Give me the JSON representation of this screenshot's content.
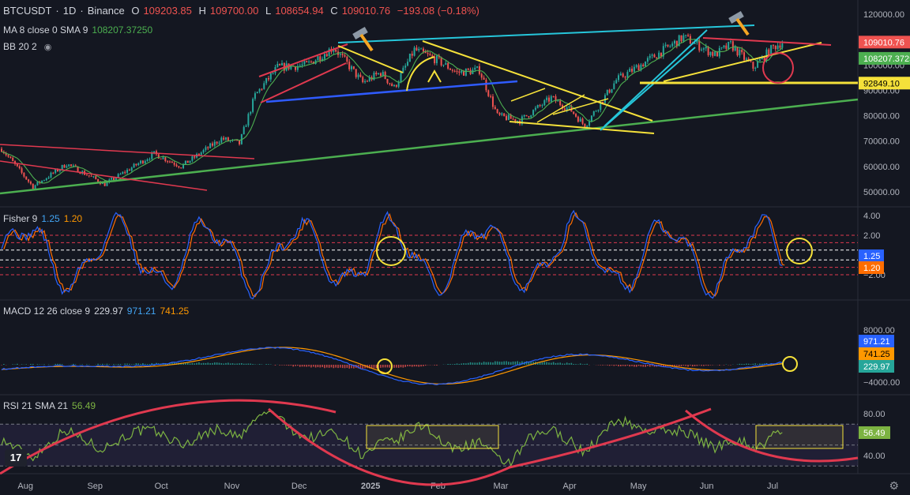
{
  "header": {
    "symbol": "BTCUSDT",
    "sep1": "·",
    "interval": "1D",
    "sep2": "·",
    "exchange": "Binance",
    "open_label": "O",
    "open": "109203.85",
    "high_label": "H",
    "high": "109700.00",
    "low_label": "L",
    "low": "108654.94",
    "close_label": "C",
    "close": "109010.76",
    "change": "−193.08 (−0.18%)"
  },
  "indicators": {
    "ma_label": "MA 8 close 0 SMA 9",
    "ma_value": "108207.37250",
    "bb_label": "BB 20 2",
    "fisher_label": "Fisher 9",
    "fisher_v1": "1.25",
    "fisher_v2": "1.20",
    "macd_label": "MACD 12 26 close 9",
    "macd_hist": "229.97",
    "macd_line": "971.21",
    "macd_signal": "741.25",
    "rsi_label": "RSI 21 SMA 21",
    "rsi_value": "56.49"
  },
  "colors": {
    "background": "#141721",
    "up": "#26a69a",
    "down": "#ef5350",
    "ma": "#4caf50",
    "fisher": "#2962ff",
    "fisher_trigger": "#ff6d00",
    "macd": "#2962ff",
    "signal": "#ff9800",
    "rsi": "#7cb342",
    "annot_red": "#e0394f",
    "annot_yellow": "#f5e13a",
    "annot_cyan": "#26c6da",
    "annot_blue": "#2f5bff",
    "annot_green": "#4caf50"
  },
  "chart_data": [
    {
      "type": "candlestick",
      "title": "BTCUSDT · 1D · Binance",
      "x_tick_labels": [
        "Aug",
        "Sep",
        "Oct",
        "Nov",
        "Dec",
        "2025",
        "Feb",
        "Mar",
        "Apr",
        "May",
        "Jun",
        "Jul"
      ],
      "y_tick_labels": [
        "120000.00",
        "110000.00",
        "100000.00",
        "90000.00",
        "80000.00",
        "70000.00",
        "60000.00",
        "50000.00"
      ],
      "ylim": [
        45000,
        122000
      ],
      "price_path": [
        [
          "Jul 22",
          67000
        ],
        [
          "Aug 5",
          52000
        ],
        [
          "Aug 20",
          61000
        ],
        [
          "Sep 6",
          53000
        ],
        [
          "Sep 28",
          65000
        ],
        [
          "Oct 10",
          60000
        ],
        [
          "Oct 28",
          71000
        ],
        [
          "Nov 5",
          69000
        ],
        [
          "Nov 12",
          88000
        ],
        [
          "Nov 22",
          99000
        ],
        [
          "Dec 5",
          100000
        ],
        [
          "Dec 17",
          107000
        ],
        [
          "Dec 30",
          93000
        ],
        [
          "Jan 7",
          97000
        ],
        [
          "Jan 13",
          91000
        ],
        [
          "Jan 22",
          106000
        ],
        [
          "Feb 1",
          102000
        ],
        [
          "Feb 10",
          97000
        ],
        [
          "Feb 20",
          98000
        ],
        [
          "Feb 28",
          80000
        ],
        [
          "Mar 10",
          78000
        ],
        [
          "Mar 24",
          87000
        ],
        [
          "Apr 2",
          82000
        ],
        [
          "Apr 8",
          76000
        ],
        [
          "Apr 22",
          94000
        ],
        [
          "May 10",
          104000
        ],
        [
          "May 22",
          111000
        ],
        [
          "Jun 5",
          104000
        ],
        [
          "Jun 12",
          108000
        ],
        [
          "Jun 22",
          99000
        ],
        [
          "Jul 1",
          107000
        ],
        [
          "Jul 5",
          109010
        ]
      ],
      "ma_series_name": "MA 8 close 0 SMA 9",
      "price_labels": [
        {
          "value": "109010.76",
          "color": "#ef5350"
        },
        {
          "value": "108207.3725",
          "color": "#4caf50"
        },
        {
          "value": "92849.10",
          "color": "#f5e13a"
        }
      ],
      "horizontal_level": 92849.1
    },
    {
      "type": "line",
      "title": "Fisher 9",
      "y_tick_labels": [
        "4.00",
        "2.00",
        "−2.00"
      ],
      "series": [
        {
          "name": "Fisher",
          "last": 1.25
        },
        {
          "name": "Trigger",
          "last": 1.2
        }
      ],
      "value_labels": [
        {
          "value": "1.25",
          "color": "#2962ff"
        },
        {
          "value": "1.20",
          "color": "#ff6d00"
        }
      ]
    },
    {
      "type": "bar",
      "title": "MACD 12 26 close 9",
      "y_tick_labels": [
        "8000.00",
        "−4000.00"
      ],
      "series": [
        {
          "name": "Histogram",
          "last": 229.97
        },
        {
          "name": "MACD",
          "last": 971.21
        },
        {
          "name": "Signal",
          "last": 741.25
        }
      ],
      "value_labels": [
        {
          "value": "971.21",
          "color": "#2962ff"
        },
        {
          "value": "741.25",
          "color": "#ff9800"
        },
        {
          "value": "229.97",
          "color": "#26a69a"
        }
      ]
    },
    {
      "type": "line",
      "title": "RSI 21 SMA 21",
      "y_tick_labels": [
        "80.00",
        "60.00",
        "40.00"
      ],
      "series": [
        {
          "name": "RSI",
          "last": 56.49
        }
      ],
      "value_labels": [
        {
          "value": "56.49",
          "color": "#7cb342"
        }
      ]
    }
  ]
}
